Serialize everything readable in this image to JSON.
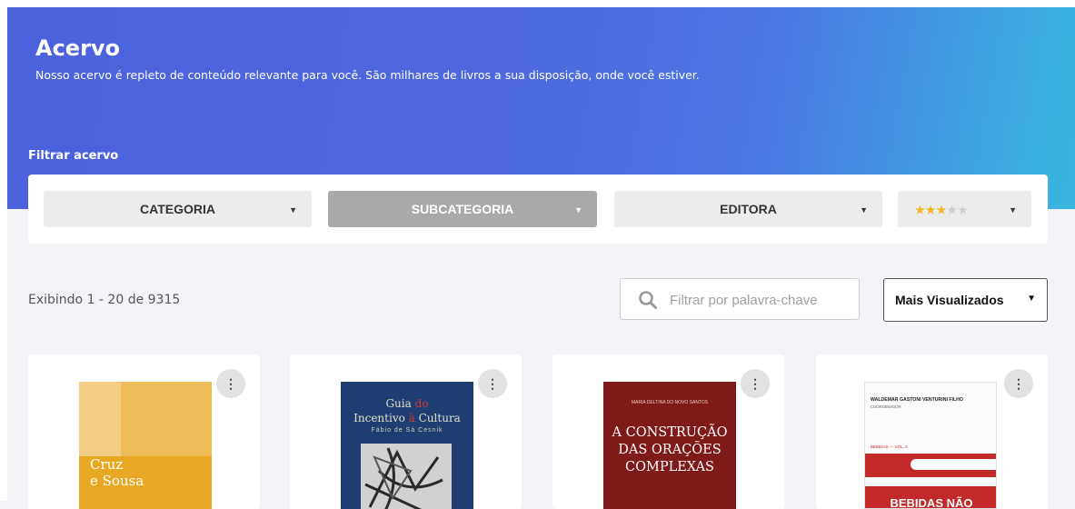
{
  "header": {
    "title": "Acervo",
    "subtitle": "Nosso acervo é repleto de conteúdo relevante para você. São milhares de livros a sua disposição, onde você estiver."
  },
  "filters": {
    "label": "Filtrar acervo",
    "category": "CATEGORIA",
    "subcategory": "SUBCATEGORIA",
    "publisher": "EDITORA",
    "rating_stars_filled": 3,
    "rating_stars_total": 5
  },
  "results": {
    "count_text": "Exibindo 1 - 20 de 9315"
  },
  "search": {
    "placeholder": "Filtrar por palavra-chave"
  },
  "sort": {
    "selected": "Mais Visualizados"
  },
  "books": [
    {
      "cover_line1": "Cruz",
      "cover_line2": "e Sousa"
    },
    {
      "cover_line1": "Guia",
      "cover_line1b": "do",
      "cover_line2": "Incentivo",
      "cover_line2b": "à",
      "cover_line2c": "Cultura",
      "cover_author": "Fábio de Sá Cesnik"
    },
    {
      "cover_author": "MARIA DELTINA DO NOVO SANTOS",
      "cover_line1": "A CONSTRUÇÃO",
      "cover_line2": "DAS ORAÇÕES",
      "cover_line3": "COMPLEXAS"
    },
    {
      "cover_author": "WALDEMAR GASTONI VENTURINI FILHO",
      "cover_role": "COORDENADOR",
      "cover_vol": "BEBIDAS — VOL. 2",
      "cover_title": "BEBIDAS NÃO"
    }
  ],
  "colors": {
    "hero_start": "#4a62db",
    "hero_end": "#38b7df",
    "star_on": "#f5b81c",
    "star_off": "#cfcfcf"
  }
}
